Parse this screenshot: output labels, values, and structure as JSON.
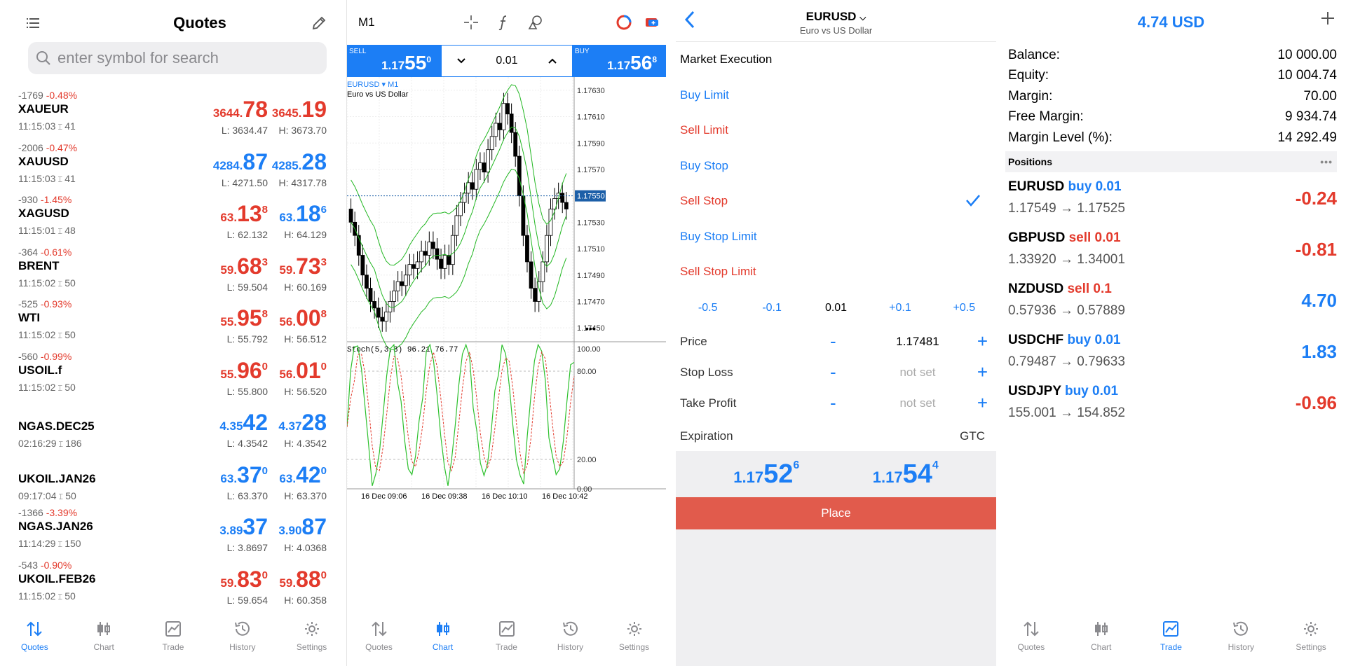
{
  "quotes": {
    "title": "Quotes",
    "search_placeholder": "enter symbol for search",
    "rows": [
      {
        "chg": "-1769",
        "pct": "-0.48%",
        "symbol": "XAUEUR",
        "time": "11:15:03",
        "spread": "41",
        "bid_a": "3644.",
        "bid_b": "78",
        "bid_c": "",
        "ask_a": "3645.",
        "ask_b": "19",
        "ask_c": "",
        "low": "L: 3634.47",
        "high": "H: 3673.70",
        "color": "red"
      },
      {
        "chg": "-2006",
        "pct": "-0.47%",
        "symbol": "XAUUSD",
        "time": "11:15:03",
        "spread": "41",
        "bid_a": "4284.",
        "bid_b": "87",
        "bid_c": "",
        "ask_a": "4285.",
        "ask_b": "28",
        "ask_c": "",
        "low": "L: 4271.50",
        "high": "H: 4317.78",
        "color": "blue"
      },
      {
        "chg": "-930",
        "pct": "-1.45%",
        "symbol": "XAGUSD",
        "time": "11:15:01",
        "spread": "48",
        "bid_a": "63.",
        "bid_b": "13",
        "bid_c": "8",
        "ask_a": "63.",
        "ask_b": "18",
        "ask_c": "6",
        "low": "L: 62.132",
        "high": "H: 64.129",
        "color": "red",
        "ask_color": "blue"
      },
      {
        "chg": "-364",
        "pct": "-0.61%",
        "symbol": "BRENT",
        "time": "11:15:02",
        "spread": "50",
        "bid_a": "59.",
        "bid_b": "68",
        "bid_c": "3",
        "ask_a": "59.",
        "ask_b": "73",
        "ask_c": "3",
        "low": "L: 59.504",
        "high": "H: 60.169",
        "color": "red"
      },
      {
        "chg": "-525",
        "pct": "-0.93%",
        "symbol": "WTI",
        "time": "11:15:02",
        "spread": "50",
        "bid_a": "55.",
        "bid_b": "95",
        "bid_c": "8",
        "ask_a": "56.",
        "ask_b": "00",
        "ask_c": "8",
        "low": "L: 55.792",
        "high": "H: 56.512",
        "color": "red"
      },
      {
        "chg": "-560",
        "pct": "-0.99%",
        "symbol": "USOIL.f",
        "time": "11:15:02",
        "spread": "50",
        "bid_a": "55.",
        "bid_b": "96",
        "bid_c": "0",
        "ask_a": "56.",
        "ask_b": "01",
        "ask_c": "0",
        "low": "L: 55.800",
        "high": "H: 56.520",
        "color": "red"
      },
      {
        "chg": "",
        "pct": "",
        "symbol": "NGAS.DEC25",
        "time": "02:16:29",
        "spread": "186",
        "bid_a": "4.35",
        "bid_b": "42",
        "bid_c": "",
        "ask_a": "4.37",
        "ask_b": "28",
        "ask_c": "",
        "low": "L: 4.3542",
        "high": "H: 4.3542",
        "color": "blue"
      },
      {
        "chg": "",
        "pct": "",
        "symbol": "UKOIL.JAN26",
        "time": "09:17:04",
        "spread": "50",
        "bid_a": "63.",
        "bid_b": "37",
        "bid_c": "0",
        "ask_a": "63.",
        "ask_b": "42",
        "ask_c": "0",
        "low": "L: 63.370",
        "high": "H: 63.370",
        "color": "blue"
      },
      {
        "chg": "-1366",
        "pct": "-3.39%",
        "symbol": "NGAS.JAN26",
        "time": "11:14:29",
        "spread": "150",
        "bid_a": "3.89",
        "bid_b": "37",
        "bid_c": "",
        "ask_a": "3.90",
        "ask_b": "87",
        "ask_c": "",
        "low": "L: 3.8697",
        "high": "H: 4.0368",
        "color": "blue"
      },
      {
        "chg": "-543",
        "pct": "-0.90%",
        "symbol": "UKOIL.FEB26",
        "time": "11:15:02",
        "spread": "50",
        "bid_a": "59.",
        "bid_b": "83",
        "bid_c": "0",
        "ask_a": "59.",
        "ask_b": "88",
        "ask_c": "0",
        "low": "L: 59.654",
        "high": "H: 60.358",
        "color": "red"
      }
    ]
  },
  "tabs": [
    "Quotes",
    "Chart",
    "Trade",
    "History",
    "Settings"
  ],
  "chart": {
    "timeframe": "M1",
    "sell_label": "SELL",
    "sell_a": "1.17",
    "sell_b": "55",
    "sell_c": "0",
    "buy_label": "BUY",
    "buy_a": "1.17",
    "buy_b": "56",
    "buy_c": "8",
    "volume": "0.01",
    "symbol": "EURUSD",
    "symbol_tf": "M1",
    "desc": "Euro vs US Dollar",
    "price_labels": [
      "1.17630",
      "1.17610",
      "1.17590",
      "1.17570",
      "1.17550",
      "1.17530",
      "1.17510",
      "1.17490",
      "1.17470",
      "1.17450"
    ],
    "current_price": "1.17550",
    "stoch_label": "Stoch(5,3,3) 96.21 76.77",
    "stoch_levels": [
      "100.00",
      "80.00",
      "20.00",
      "0.00"
    ],
    "time_labels": [
      "16 Dec 09:06",
      "16 Dec 09:38",
      "16 Dec 10:10",
      "16 Dec 10:42"
    ],
    "more": "•••",
    "colors": {
      "bands": "#22b722",
      "stoch_main": "#2ec12e",
      "stoch_signal": "#e33a2c",
      "current": "#1c5fa8"
    }
  },
  "chart_data": {
    "type": "candlestick",
    "symbol": "EURUSD",
    "timeframe": "M1",
    "ylim": [
      1.1744,
      1.1764
    ],
    "xlabels": [
      "16 Dec 09:06",
      "16 Dec 09:38",
      "16 Dec 10:10",
      "16 Dec 10:42"
    ],
    "close": [
      1.1753,
      1.1752,
      1.17505,
      1.1749,
      1.1748,
      1.1747,
      1.17465,
      1.17458,
      1.17455,
      1.17462,
      1.1747,
      1.17478,
      1.17485,
      1.17482,
      1.1749,
      1.17498,
      1.17495,
      1.175,
      1.17508,
      1.17505,
      1.17515,
      1.1751,
      1.17502,
      1.17495,
      1.17505,
      1.17498,
      1.1752,
      1.17535,
      1.17545,
      1.17552,
      1.1756,
      1.17555,
      1.1757,
      1.17575,
      1.17568,
      1.17585,
      1.17595,
      1.17605,
      1.176,
      1.1762,
      1.17612,
      1.17598,
      1.1758,
      1.1755,
      1.1752,
      1.175,
      1.1748,
      1.1747,
      1.17485,
      1.175,
      1.1752,
      1.1754,
      1.17548,
      1.17552,
      1.17545,
      1.1754
    ],
    "stochastic": {
      "main_last": 96.21,
      "signal_last": 76.77,
      "levels": [
        80,
        20
      ]
    }
  },
  "order": {
    "symbol": "EURUSD",
    "desc": "Euro vs US Dollar",
    "types": [
      "Market Execution",
      "Buy Limit",
      "Sell Limit",
      "Buy Stop",
      "Sell Stop",
      "Buy Stop Limit",
      "Sell Stop Limit"
    ],
    "selected": "Sell Stop",
    "vol_steps": [
      "-0.5",
      "-0.1",
      "0.01",
      "+0.1",
      "+0.5"
    ],
    "price_label": "Price",
    "price_value": "1.17481",
    "sl_label": "Stop Loss",
    "sl_value": "not set",
    "tp_label": "Take Profit",
    "tp_value": "not set",
    "minus": "-",
    "plus": "+",
    "exp_label": "Expiration",
    "exp_value": "GTC",
    "bid_a": "1.17",
    "bid_b": "52",
    "bid_c": "6",
    "ask_a": "1.17",
    "ask_b": "54",
    "ask_c": "4",
    "place": "Place"
  },
  "account": {
    "profit": "4.74 USD",
    "rows": [
      {
        "label": "Balance:",
        "value": "10 000.00"
      },
      {
        "label": "Equity:",
        "value": "10 004.74"
      },
      {
        "label": "Margin:",
        "value": "70.00"
      },
      {
        "label": "Free Margin:",
        "value": "9 934.74"
      },
      {
        "label": "Margin Level (%):",
        "value": "14 292.49"
      }
    ],
    "positions_label": "Positions",
    "positions": [
      {
        "symbol": "EURUSD",
        "side": "buy 0.01",
        "prices": "1.17549 → 1.17525",
        "pl": "-0.24",
        "side_color": "blue",
        "pl_color": "red"
      },
      {
        "symbol": "GBPUSD",
        "side": "sell 0.01",
        "prices": "1.33920 → 1.34001",
        "pl": "-0.81",
        "side_color": "red",
        "pl_color": "red"
      },
      {
        "symbol": "NZDUSD",
        "side": "sell 0.1",
        "prices": "0.57936 → 0.57889",
        "pl": "4.70",
        "side_color": "red",
        "pl_color": "blue"
      },
      {
        "symbol": "USDCHF",
        "side": "buy 0.01",
        "prices": "0.79487 → 0.79633",
        "pl": "1.83",
        "side_color": "blue",
        "pl_color": "blue"
      },
      {
        "symbol": "USDJPY",
        "side": "buy 0.01",
        "prices": "155.001 → 154.852",
        "pl": "-0.96",
        "side_color": "blue",
        "pl_color": "red"
      }
    ]
  }
}
